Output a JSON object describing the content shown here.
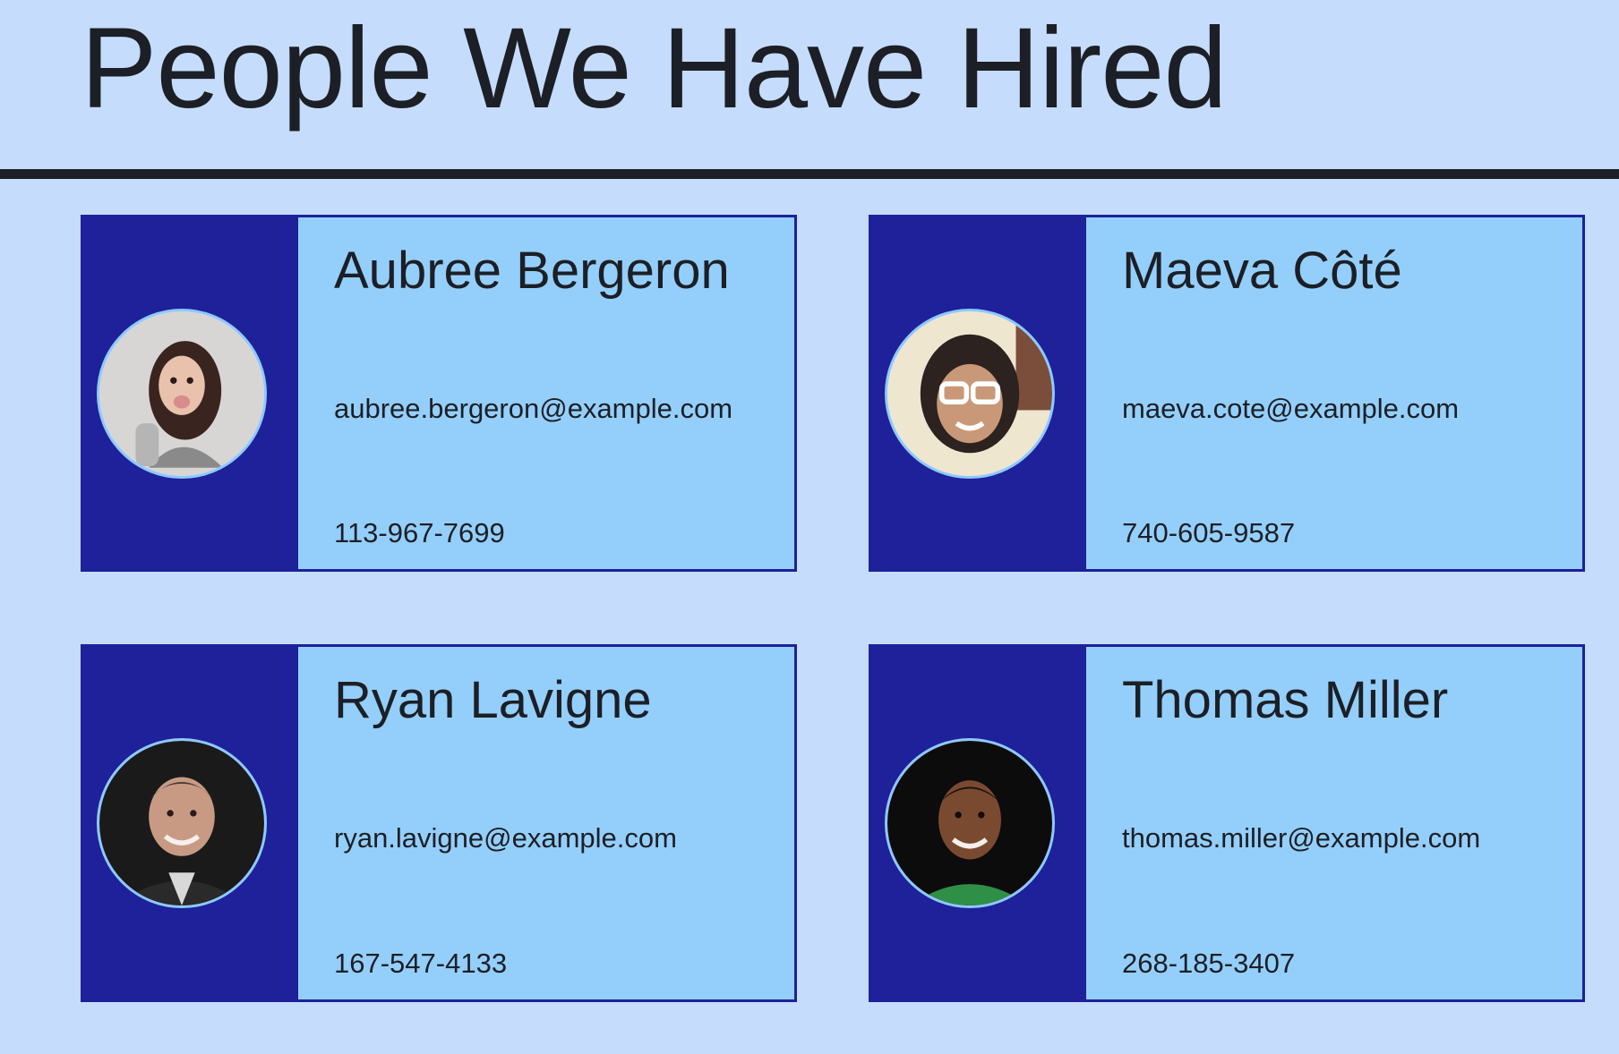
{
  "header": {
    "title": "People We Have Hired"
  },
  "colors": {
    "background": "#c5dcfc",
    "card_side": "#1e2199",
    "card_body": "#94cffb",
    "text": "#1c1f26",
    "avatar_ring": "#8ec9ff"
  },
  "people": [
    {
      "name": "Aubree Bergeron",
      "email": "aubree.bergeron@example.com",
      "phone": "113-967-7699",
      "avatar_icon": "person-photo-icon"
    },
    {
      "name": "Maeva Côté",
      "email": "maeva.cote@example.com",
      "phone": "740-605-9587",
      "avatar_icon": "person-photo-icon"
    },
    {
      "name": "Ryan Lavigne",
      "email": "ryan.lavigne@example.com",
      "phone": "167-547-4133",
      "avatar_icon": "person-photo-icon"
    },
    {
      "name": "Thomas Miller",
      "email": "thomas.miller@example.com",
      "phone": "268-185-3407",
      "avatar_icon": "person-photo-icon"
    }
  ]
}
